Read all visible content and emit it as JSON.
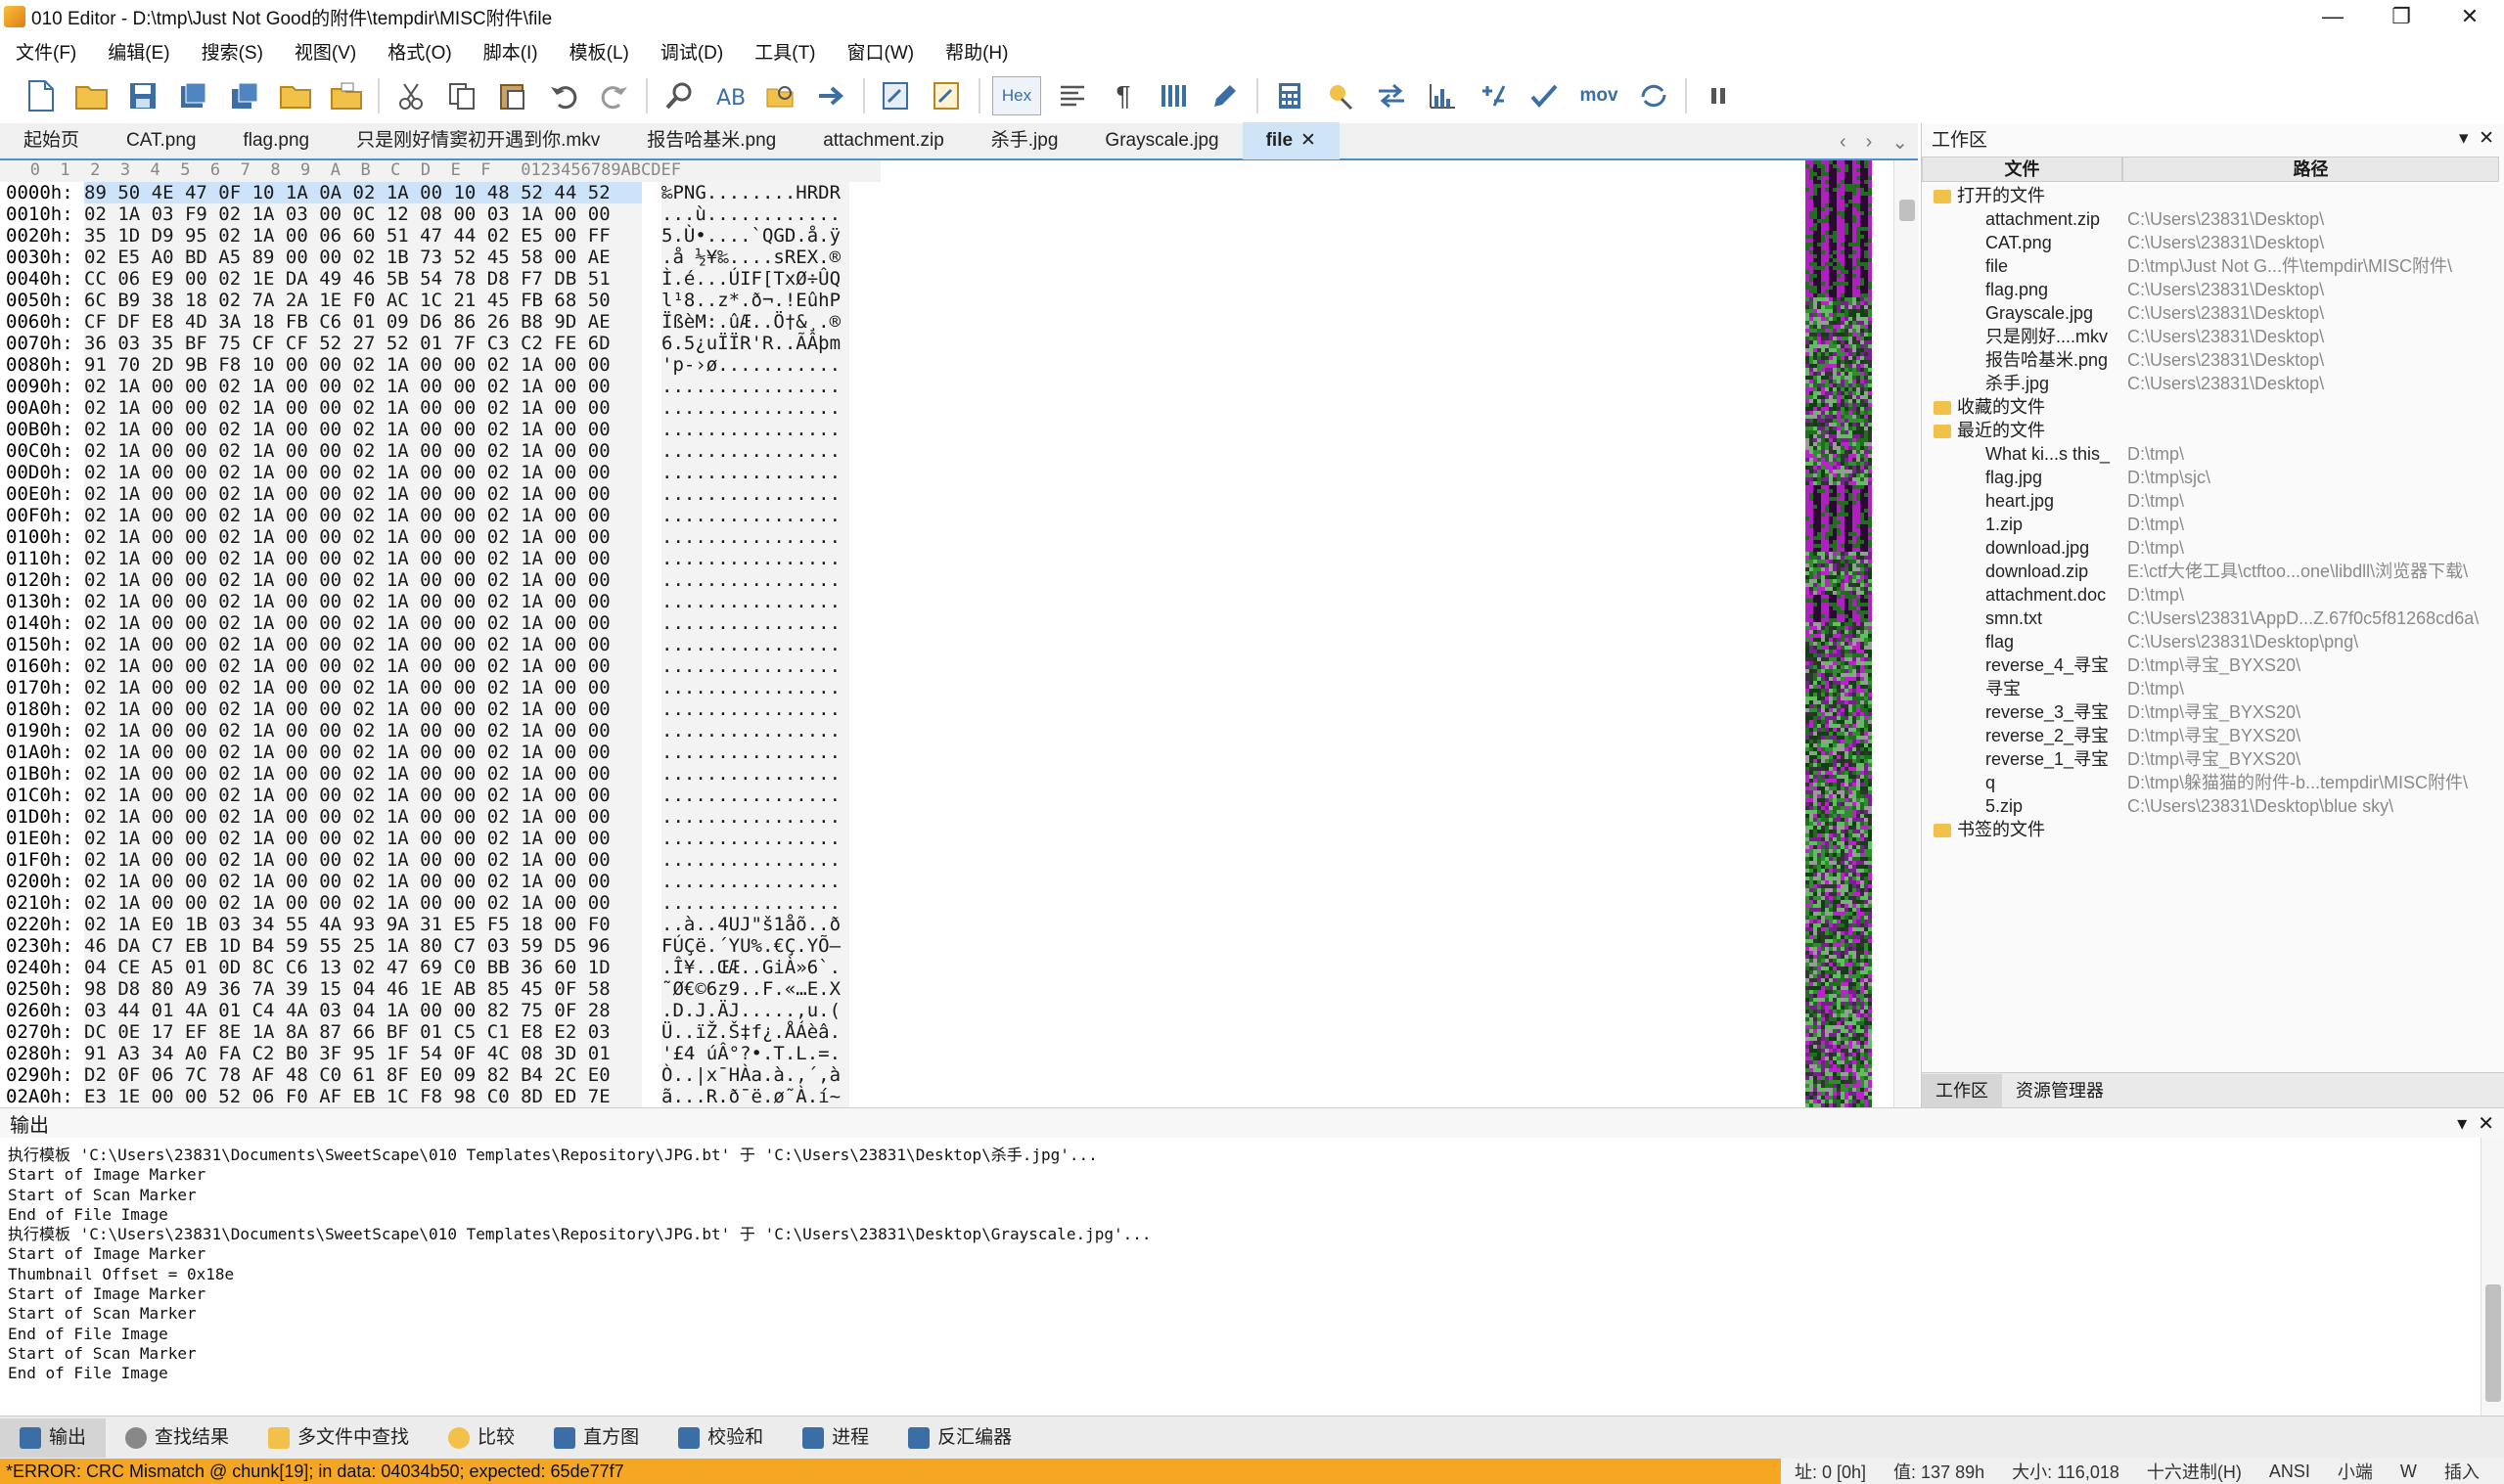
{
  "window": {
    "title": "010 Editor - D:\\tmp\\Just Not Good的附件\\tempdir\\MISC附件\\file"
  },
  "menu": [
    "文件(F)",
    "编辑(E)",
    "搜索(S)",
    "视图(V)",
    "格式(O)",
    "脚本(I)",
    "模板(L)",
    "调试(D)",
    "工具(T)",
    "窗口(W)",
    "帮助(H)"
  ],
  "toolbar": {
    "hex_label": "Hex",
    "mov_label": "mov"
  },
  "tabs": [
    "起始页",
    "CAT.png",
    "flag.png",
    "只是刚好情窦初开遇到你.mkv",
    "报告哈基米.png",
    "attachment.zip",
    "杀手.jpg",
    "Grayscale.jpg",
    "file"
  ],
  "hex": {
    "header": "   0  1  2  3  4  5  6  7  8  9  A  B  C  D  E  F   0123456789ABCDEF",
    "rows": [
      {
        "a": "0000h:",
        "b": "89 50 4E 47 0F 10 1A 0A 02 1A 00 10 48 52 44 52",
        "c": "‰PNG........HRDR"
      },
      {
        "a": "0010h:",
        "b": "02 1A 03 F9 02 1A 03 00 0C 12 08 00 03 1A 00 00",
        "c": "...ù............"
      },
      {
        "a": "0020h:",
        "b": "35 1D D9 95 02 1A 00 06 60 51 47 44 02 E5 00 FF",
        "c": "5.Ù•....`QGD.å.ÿ"
      },
      {
        "a": "0030h:",
        "b": "02 E5 A0 BD A5 89 00 00 02 1B 73 52 45 58 00 AE",
        "c": ".å ½¥‰....sREX.®"
      },
      {
        "a": "0040h:",
        "b": "CC 06 E9 00 02 1E DA 49 46 5B 54 78 D8 F7 DB 51",
        "c": "Ì.é...ÚIF[TxØ÷ÛQ"
      },
      {
        "a": "0050h:",
        "b": "6C B9 38 18 02 7A 2A 1E F0 AC 1C 21 45 FB 68 50",
        "c": "l¹8..z*.ð¬.!EûhP"
      },
      {
        "a": "0060h:",
        "b": "CF DF E8 4D 3A 18 FB C6 01 09 D6 86 26 B8 9D AE",
        "c": "ÏßèM:.ûÆ..Ö†&¸.®"
      },
      {
        "a": "0070h:",
        "b": "36 03 35 BF 75 CF CF 52 27 52 01 7F C3 C2 FE 6D",
        "c": "6.5¿uÏÏR'R..ÃÂþm"
      },
      {
        "a": "0080h:",
        "b": "91 70 2D 9B F8 10 00 00 02 1A 00 00 02 1A 00 00",
        "c": "'p-›ø..........."
      },
      {
        "a": "0090h:",
        "b": "02 1A 00 00 02 1A 00 00 02 1A 00 00 02 1A 00 00",
        "c": "................"
      },
      {
        "a": "00A0h:",
        "b": "02 1A 00 00 02 1A 00 00 02 1A 00 00 02 1A 00 00",
        "c": "................"
      },
      {
        "a": "00B0h:",
        "b": "02 1A 00 00 02 1A 00 00 02 1A 00 00 02 1A 00 00",
        "c": "................"
      },
      {
        "a": "00C0h:",
        "b": "02 1A 00 00 02 1A 00 00 02 1A 00 00 02 1A 00 00",
        "c": "................"
      },
      {
        "a": "00D0h:",
        "b": "02 1A 00 00 02 1A 00 00 02 1A 00 00 02 1A 00 00",
        "c": "................"
      },
      {
        "a": "00E0h:",
        "b": "02 1A 00 00 02 1A 00 00 02 1A 00 00 02 1A 00 00",
        "c": "................"
      },
      {
        "a": "00F0h:",
        "b": "02 1A 00 00 02 1A 00 00 02 1A 00 00 02 1A 00 00",
        "c": "................"
      },
      {
        "a": "0100h:",
        "b": "02 1A 00 00 02 1A 00 00 02 1A 00 00 02 1A 00 00",
        "c": "................"
      },
      {
        "a": "0110h:",
        "b": "02 1A 00 00 02 1A 00 00 02 1A 00 00 02 1A 00 00",
        "c": "................"
      },
      {
        "a": "0120h:",
        "b": "02 1A 00 00 02 1A 00 00 02 1A 00 00 02 1A 00 00",
        "c": "................"
      },
      {
        "a": "0130h:",
        "b": "02 1A 00 00 02 1A 00 00 02 1A 00 00 02 1A 00 00",
        "c": "................"
      },
      {
        "a": "0140h:",
        "b": "02 1A 00 00 02 1A 00 00 02 1A 00 00 02 1A 00 00",
        "c": "................"
      },
      {
        "a": "0150h:",
        "b": "02 1A 00 00 02 1A 00 00 02 1A 00 00 02 1A 00 00",
        "c": "................"
      },
      {
        "a": "0160h:",
        "b": "02 1A 00 00 02 1A 00 00 02 1A 00 00 02 1A 00 00",
        "c": "................"
      },
      {
        "a": "0170h:",
        "b": "02 1A 00 00 02 1A 00 00 02 1A 00 00 02 1A 00 00",
        "c": "................"
      },
      {
        "a": "0180h:",
        "b": "02 1A 00 00 02 1A 00 00 02 1A 00 00 02 1A 00 00",
        "c": "................"
      },
      {
        "a": "0190h:",
        "b": "02 1A 00 00 02 1A 00 00 02 1A 00 00 02 1A 00 00",
        "c": "................"
      },
      {
        "a": "01A0h:",
        "b": "02 1A 00 00 02 1A 00 00 02 1A 00 00 02 1A 00 00",
        "c": "................"
      },
      {
        "a": "01B0h:",
        "b": "02 1A 00 00 02 1A 00 00 02 1A 00 00 02 1A 00 00",
        "c": "................"
      },
      {
        "a": "01C0h:",
        "b": "02 1A 00 00 02 1A 00 00 02 1A 00 00 02 1A 00 00",
        "c": "................"
      },
      {
        "a": "01D0h:",
        "b": "02 1A 00 00 02 1A 00 00 02 1A 00 00 02 1A 00 00",
        "c": "................"
      },
      {
        "a": "01E0h:",
        "b": "02 1A 00 00 02 1A 00 00 02 1A 00 00 02 1A 00 00",
        "c": "................"
      },
      {
        "a": "01F0h:",
        "b": "02 1A 00 00 02 1A 00 00 02 1A 00 00 02 1A 00 00",
        "c": "................"
      },
      {
        "a": "0200h:",
        "b": "02 1A 00 00 02 1A 00 00 02 1A 00 00 02 1A 00 00",
        "c": "................"
      },
      {
        "a": "0210h:",
        "b": "02 1A 00 00 02 1A 00 00 02 1A 00 00 02 1A 00 00",
        "c": "................"
      },
      {
        "a": "0220h:",
        "b": "02 1A E0 1B 03 34 55 4A 93 9A 31 E5 F5 18 00 F0",
        "c": "..à..4UJ\"š1åõ..ð"
      },
      {
        "a": "0230h:",
        "b": "46 DA C7 EB 1D B4 59 55 25 1A 80 C7 03 59 D5 96",
        "c": "FÚÇë.´YU%.€Ç.YÕ–"
      },
      {
        "a": "0240h:",
        "b": "04 CE A5 01 0D 8C C6 13 02 47 69 C0 BB 36 60 1D",
        "c": ".Î¥..ŒÆ..GiÀ»6`."
      },
      {
        "a": "0250h:",
        "b": "98 D8 80 A9 36 7A 39 15 04 46 1E AB 85 45 0F 58",
        "c": "˜Ø€©6z9..F.«…E.X"
      },
      {
        "a": "0260h:",
        "b": "03 44 01 4A 01 C4 4A 03 04 1A 00 00 82 75 0F 28",
        "c": ".D.J.ÄJ.....‚u.("
      },
      {
        "a": "0270h:",
        "b": "DC 0E 17 EF 8E 1A 8A 87 66 BF 01 C5 C1 E8 E2 03",
        "c": "Ü..ïŽ.Š‡f¿.ÅÁèâ."
      },
      {
        "a": "0280h:",
        "b": "91 A3 34 A0 FA C2 B0 3F 95 1F 54 0F 4C 08 3D 01",
        "c": "'£4 úÂ°?•.T.L.=."
      },
      {
        "a": "0290h:",
        "b": "D2 0F 06 7C 78 AF 48 C0 61 8F E0 09 82 B4 2C E0",
        "c": "Ò..|x¯HÀa.à.‚´,à"
      },
      {
        "a": "02A0h:",
        "b": "E3 1E 00 00 52 06 F0 AF EB 1C F8 98 C0 8D ED 7E",
        "c": "ã...R.ð¯ë.ø˜À.í~"
      }
    ]
  },
  "workspace": {
    "title": "工作区",
    "col_file": "文件",
    "col_path": "路径",
    "open_files_label": "打开的文件",
    "open_files": [
      {
        "name": "attachment.zip",
        "path": "C:\\Users\\23831\\Desktop\\"
      },
      {
        "name": "CAT.png",
        "path": "C:\\Users\\23831\\Desktop\\"
      },
      {
        "name": "file",
        "path": "D:\\tmp\\Just Not G...件\\tempdir\\MISC附件\\"
      },
      {
        "name": "flag.png",
        "path": "C:\\Users\\23831\\Desktop\\"
      },
      {
        "name": "Grayscale.jpg",
        "path": "C:\\Users\\23831\\Desktop\\"
      },
      {
        "name": "只是刚好....mkv",
        "path": "C:\\Users\\23831\\Desktop\\"
      },
      {
        "name": "报告哈基米.png",
        "path": "C:\\Users\\23831\\Desktop\\"
      },
      {
        "name": "杀手.jpg",
        "path": "C:\\Users\\23831\\Desktop\\"
      }
    ],
    "favorites_label": "收藏的文件",
    "recent_label": "最近的文件",
    "recent_files": [
      {
        "name": "What ki...s this_",
        "path": "D:\\tmp\\"
      },
      {
        "name": "flag.jpg",
        "path": "D:\\tmp\\sjc\\"
      },
      {
        "name": "heart.jpg",
        "path": "D:\\tmp\\"
      },
      {
        "name": "1.zip",
        "path": "D:\\tmp\\"
      },
      {
        "name": "download.jpg",
        "path": "D:\\tmp\\"
      },
      {
        "name": "download.zip",
        "path": "E:\\ctf大佬工具\\ctftoo...one\\libdll\\浏览器下载\\"
      },
      {
        "name": "attachment.doc",
        "path": "D:\\tmp\\"
      },
      {
        "name": "smn.txt",
        "path": "C:\\Users\\23831\\AppD...Z.67f0c5f81268cd6a\\"
      },
      {
        "name": "flag",
        "path": "C:\\Users\\23831\\Desktop\\png\\"
      },
      {
        "name": "reverse_4_寻宝",
        "path": "D:\\tmp\\寻宝_BYXS20\\"
      },
      {
        "name": "寻宝",
        "path": "D:\\tmp\\"
      },
      {
        "name": "reverse_3_寻宝",
        "path": "D:\\tmp\\寻宝_BYXS20\\"
      },
      {
        "name": "reverse_2_寻宝",
        "path": "D:\\tmp\\寻宝_BYXS20\\"
      },
      {
        "name": "reverse_1_寻宝",
        "path": "D:\\tmp\\寻宝_BYXS20\\"
      },
      {
        "name": "q",
        "path": "D:\\tmp\\躲猫猫的附件-b...tempdir\\MISC附件\\"
      },
      {
        "name": "5.zip",
        "path": "C:\\Users\\23831\\Desktop\\blue sky\\"
      }
    ],
    "bookmarks_label": "书签的文件",
    "footer_tabs": [
      "工作区",
      "资源管理器"
    ]
  },
  "output": {
    "title": "输出",
    "lines": [
      "执行模板 'C:\\Users\\23831\\Documents\\SweetScape\\010 Templates\\Repository\\JPG.bt' 于 'C:\\Users\\23831\\Desktop\\杀手.jpg'...",
      "Start of Image Marker",
      "Start of Scan Marker",
      "End of File Image",
      "执行模板 'C:\\Users\\23831\\Documents\\SweetScape\\010 Templates\\Repository\\JPG.bt' 于 'C:\\Users\\23831\\Desktop\\Grayscale.jpg'...",
      "Start of Image Marker",
      "Thumbnail Offset = 0x18e",
      "Start of Image Marker",
      "Start of Scan Marker",
      "End of File Image",
      "Start of Scan Marker",
      "End of File Image"
    ]
  },
  "bottom_tabs": [
    "输出",
    "查找结果",
    "多文件中查找",
    "比较",
    "直方图",
    "校验和",
    "进程",
    "反汇编器"
  ],
  "status": {
    "error": "*ERROR: CRC Mismatch @ chunk[19]; in data: 04034b50; expected: 65de77f7",
    "addr": "址: 0 [0h]",
    "value": "值: 137 89h",
    "size": "大小: 116,018",
    "mode": "十六进制(H)",
    "encoding": "ANSI",
    "endian": "小端",
    "w": "W",
    "insert": "插入"
  },
  "colors": {
    "accent": "#4a90d9",
    "error_bg": "#f5a623",
    "selection": "#cde3f9"
  }
}
